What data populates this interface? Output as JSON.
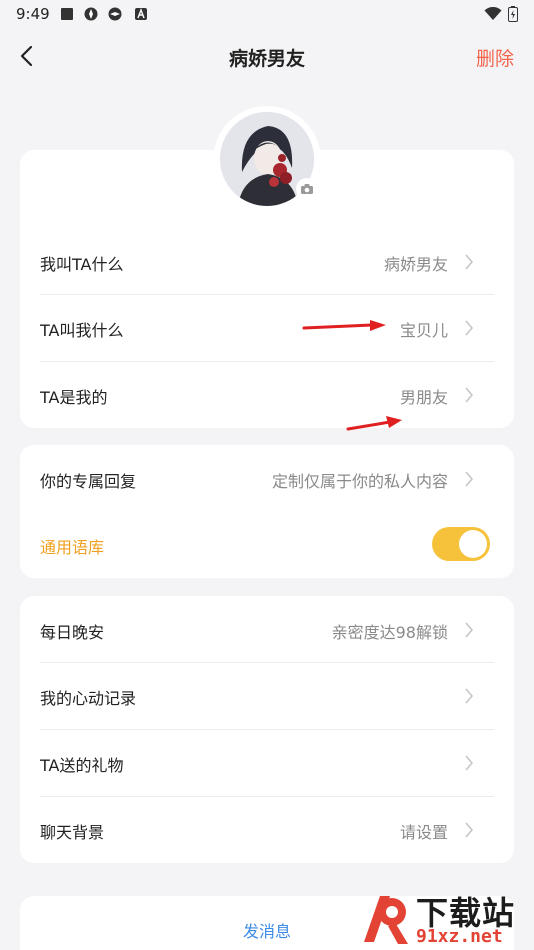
{
  "status_bar": {
    "time": "9:49"
  },
  "header": {
    "title": "病娇男友",
    "delete_label": "删除"
  },
  "profile_card": {
    "rows": [
      {
        "label": "我叫TA什么",
        "value": "病娇男友"
      },
      {
        "label": "TA叫我什么",
        "value": "宝贝儿"
      },
      {
        "label": "TA是我的",
        "value": "男朋友"
      }
    ]
  },
  "reply_card": {
    "exclusive_reply": {
      "label": "你的专属回复",
      "value": "定制仅属于你的私人内容"
    },
    "general_library": {
      "label": "通用语库",
      "enabled": true
    }
  },
  "extras_card": {
    "rows": [
      {
        "label": "每日晚安",
        "value": "亲密度达98解锁"
      },
      {
        "label": "我的心动记录",
        "value": ""
      },
      {
        "label": "TA送的礼物",
        "value": ""
      },
      {
        "label": "聊天背景",
        "value": "请设置"
      }
    ]
  },
  "footer": {
    "send_label": "发消息"
  },
  "watermark": {
    "title": "下载站",
    "url": "91xz.net"
  },
  "colors": {
    "accent_orange": "#f0a020",
    "toggle_on": "#f7c23b",
    "delete_red": "#f4644b",
    "link_blue": "#3b8be8"
  }
}
